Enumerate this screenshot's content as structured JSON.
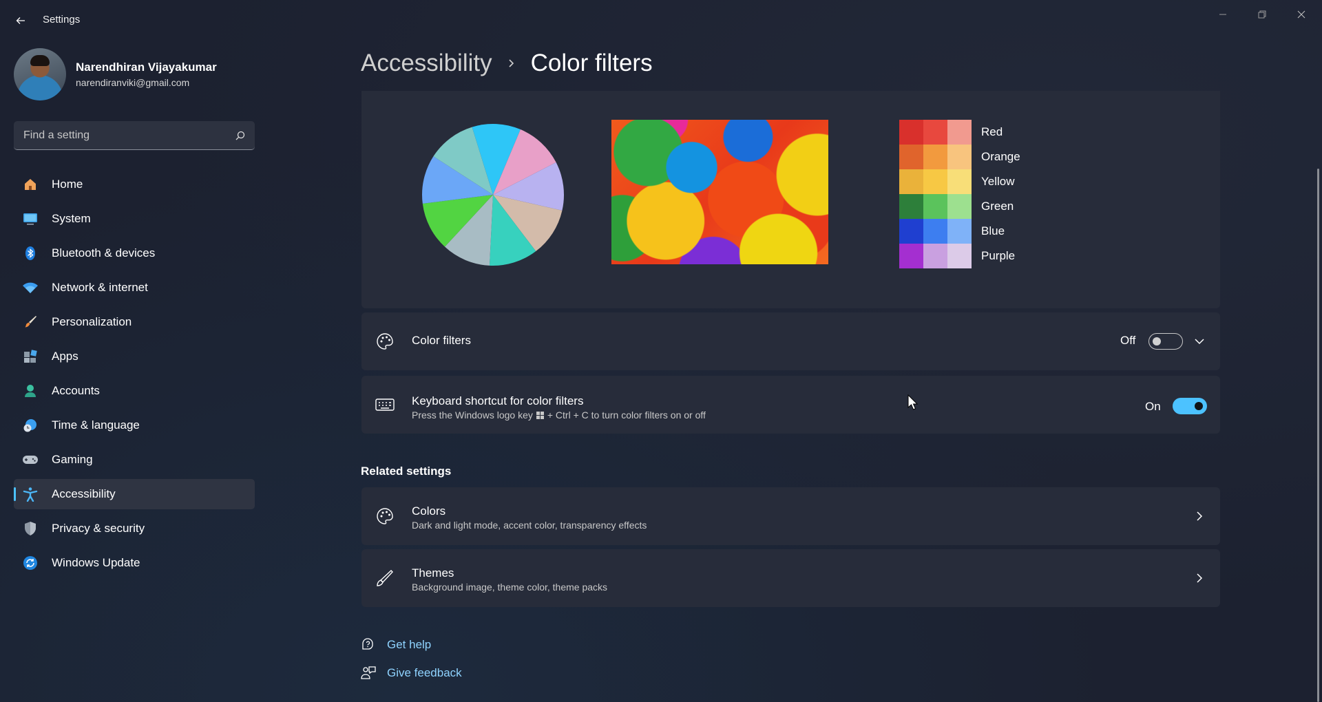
{
  "titlebar": {
    "title": "Settings"
  },
  "profile": {
    "name": "Narendhiran Vijayakumar",
    "email": "narendiranviki@gmail.com"
  },
  "search": {
    "placeholder": "Find a setting"
  },
  "nav": [
    {
      "label": "Home",
      "icon": "home-icon"
    },
    {
      "label": "System",
      "icon": "monitor-icon"
    },
    {
      "label": "Bluetooth & devices",
      "icon": "bluetooth-icon"
    },
    {
      "label": "Network & internet",
      "icon": "wifi-icon"
    },
    {
      "label": "Personalization",
      "icon": "brush-icon"
    },
    {
      "label": "Apps",
      "icon": "apps-icon"
    },
    {
      "label": "Accounts",
      "icon": "person-icon"
    },
    {
      "label": "Time & language",
      "icon": "globe-clock-icon"
    },
    {
      "label": "Gaming",
      "icon": "gamepad-icon"
    },
    {
      "label": "Accessibility",
      "icon": "accessibility-icon",
      "active": true
    },
    {
      "label": "Privacy & security",
      "icon": "shield-icon"
    },
    {
      "label": "Windows Update",
      "icon": "update-icon"
    }
  ],
  "breadcrumb": {
    "parent": "Accessibility",
    "current": "Color filters"
  },
  "preview": {
    "palette": [
      {
        "label": "Red",
        "colors": [
          "#d9302c",
          "#e8483e",
          "#f19a8f"
        ]
      },
      {
        "label": "Orange",
        "colors": [
          "#e0642c",
          "#f29a3e",
          "#f8c47e"
        ]
      },
      {
        "label": "Yellow",
        "colors": [
          "#eab23a",
          "#f7c844",
          "#f8de78"
        ]
      },
      {
        "label": "Green",
        "colors": [
          "#2d7f3a",
          "#5bc35c",
          "#9de08f"
        ]
      },
      {
        "label": "Blue",
        "colors": [
          "#1f3fd0",
          "#3d7ef0",
          "#7fb2f8"
        ]
      },
      {
        "label": "Purple",
        "colors": [
          "#a42fd0",
          "#c9a0e0",
          "#dccbe8"
        ]
      }
    ],
    "pie_colors": [
      "#2ec6f7",
      "#e8a0c8",
      "#b8b2f0",
      "#d3bbaa",
      "#37d1be",
      "#a8bcc4",
      "#52d442",
      "#6ba7f7",
      "#7fcac6"
    ]
  },
  "color_filters": {
    "title": "Color filters",
    "state": "Off"
  },
  "keyboard_shortcut": {
    "title": "Keyboard shortcut for color filters",
    "subtitle_before": "Press the Windows logo key",
    "subtitle_after": "+ Ctrl + C to turn color filters on or off",
    "state": "On"
  },
  "related": {
    "heading": "Related settings",
    "items": [
      {
        "title": "Colors",
        "subtitle": "Dark and light mode, accent color, transparency effects"
      },
      {
        "title": "Themes",
        "subtitle": "Background image, theme color, theme packs"
      }
    ]
  },
  "help": {
    "get_help": "Get help",
    "give_feedback": "Give feedback"
  },
  "colors": {
    "accent": "#4cc2ff",
    "link": "#8fd3ff"
  }
}
